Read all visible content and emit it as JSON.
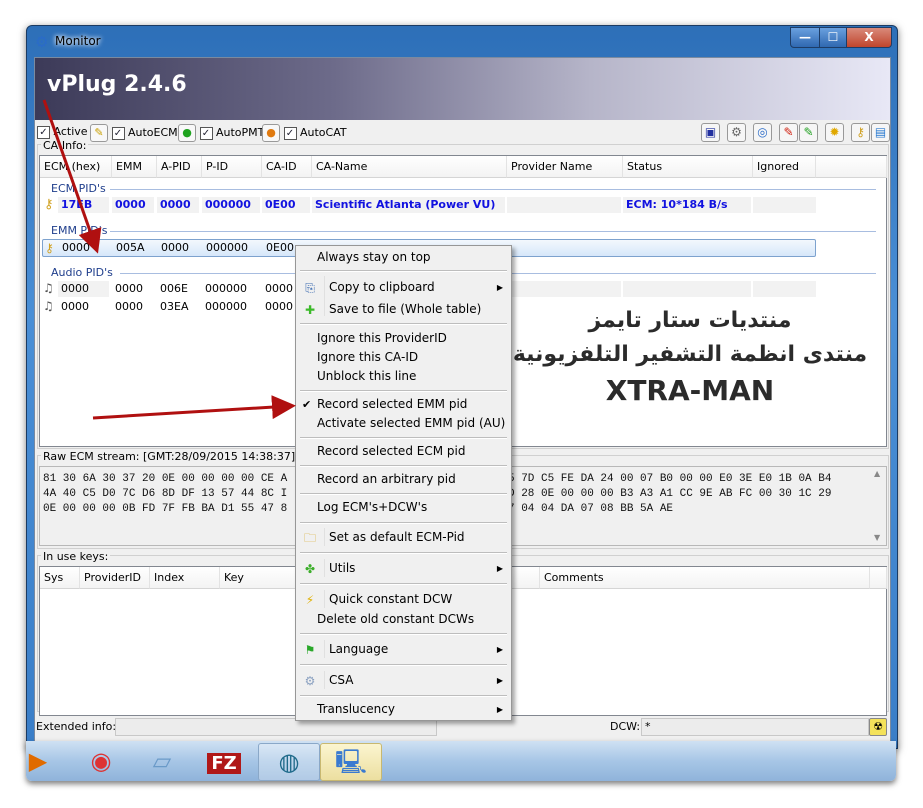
{
  "window": {
    "title": "Monitor",
    "app_banner": "vPlug 2.4.6",
    "controls": {
      "minimize": "—",
      "maximize": "☐",
      "close": "X"
    }
  },
  "toolbar": {
    "checkboxes": [
      {
        "label": "Active",
        "checked": true,
        "icon": "none"
      },
      {
        "label": "AutoECM",
        "checked": true,
        "icon": "screwdriver-icon"
      },
      {
        "label": "AutoPMT",
        "checked": true,
        "icon": "green-globe-icon"
      },
      {
        "label": "AutoCAT",
        "checked": true,
        "icon": "orange-globe-icon"
      }
    ],
    "right_icons": [
      "save-icon",
      "gear-export-icon",
      "refresh-settings-icon",
      "red-screwdriver-icon",
      "green-screwdriver-icon",
      "yellow-gear-icon",
      "key-icon",
      "database-icon"
    ]
  },
  "ca_info": {
    "group_label": "CA-Info:",
    "columns": [
      "ECM (hex)",
      "EMM",
      "A-PID",
      "P-ID",
      "CA-ID",
      "CA-Name",
      "Provider Name",
      "Status",
      "Ignored"
    ],
    "sections": {
      "ecm": "ECM PID's",
      "emm": "EMM PID's",
      "audio": "Audio PID's"
    },
    "ecm_rows": [
      {
        "ecm": "17EB",
        "emm": "0000",
        "apid": "0000",
        "pid": "000000",
        "caid": "0E00",
        "ca_name": "Scientific Atlanta (Power VU)",
        "provider": "",
        "status": "ECM: 10*184 B/s",
        "ignored": ""
      }
    ],
    "emm_rows": [
      {
        "ecm": "0000",
        "emm": "005A",
        "apid": "0000",
        "pid": "000000",
        "caid": "0E00"
      }
    ],
    "audio_rows": [
      {
        "ecm": "0000",
        "emm": "0000",
        "apid": "006E",
        "pid": "000000",
        "caid": "0000"
      },
      {
        "ecm": "0000",
        "emm": "0000",
        "apid": "03EA",
        "pid": "000000",
        "caid": "0000"
      }
    ]
  },
  "watermark": {
    "line1": "منتديات ستار تايمز",
    "line2": "منتدى انظمة التشفير التلفزيونية",
    "line3": "XTRA-MAN"
  },
  "raw_ecm": {
    "label": "Raw ECM stream: [GMT:28/09/2015 14:38:37]",
    "lines_left": [
      "81 30 6A 30 37 20 0E 00 00 00 00 CE A",
      "4A 40 C5 D0 7C D6 8D DF 13 57 44 8C I",
      "0E 00 00 00 0B FD 7F FB BA D1 55 47 8"
    ],
    "lines_right": [
      "5 7D C5 FE DA 24 00 07 B0 00 00 E0 3E E0 1B 0A B4",
      "D 28 0E 00 00 00 B3 A3 A1 CC 9E AB FC 00 30 1C 29",
      "7 04 04 DA 07 08 BB 5A AE"
    ]
  },
  "keys": {
    "group_label": "In use keys:",
    "columns": [
      "Sys",
      "ProviderID",
      "Index",
      "Key",
      "Comments"
    ]
  },
  "status_bar": {
    "extended_label": "Extended info:",
    "extended_value": "",
    "dcw_label": "DCW:",
    "dcw_value": "*"
  },
  "context_menu": {
    "items": [
      {
        "label": "Always stay on top"
      },
      {
        "label": "Copy to clipboard",
        "icon": "copy-icon",
        "submenu": true
      },
      {
        "label": "Save to file (Whole table)",
        "icon": "green-plus-icon"
      },
      {
        "label": "Ignore this ProviderID"
      },
      {
        "label": "Ignore this CA-ID"
      },
      {
        "label": "Unblock this line"
      },
      {
        "label": "Record selected EMM pid",
        "checked": true
      },
      {
        "label": "Activate selected EMM pid (AU)"
      },
      {
        "label": "Record selected ECM pid"
      },
      {
        "label": "Record an arbitrary pid"
      },
      {
        "label": "Log ECM's+DCW's"
      },
      {
        "label": "Set as default ECM-Pid",
        "icon": "folder-icon"
      },
      {
        "label": "Utils",
        "icon": "puzzle-icon",
        "submenu": true
      },
      {
        "label": "Quick constant DCW",
        "icon": "lightning-icon"
      },
      {
        "label": "Delete old constant DCWs"
      },
      {
        "label": "Language",
        "icon": "flag-icon",
        "submenu": true
      },
      {
        "label": "CSA",
        "icon": "gear-icon",
        "submenu": true
      },
      {
        "label": "Translucency",
        "submenu": true
      }
    ]
  },
  "taskbar": {
    "apps": [
      "media-player-icon",
      "chrome-icon",
      "notepad-icon",
      "filezilla-icon",
      "network-server-icon",
      "satellite-monitor-icon"
    ]
  },
  "colors": {
    "ecm_row_text": "#1212e0",
    "section_text": "#1f3e8c",
    "arrow": "#b01010"
  }
}
